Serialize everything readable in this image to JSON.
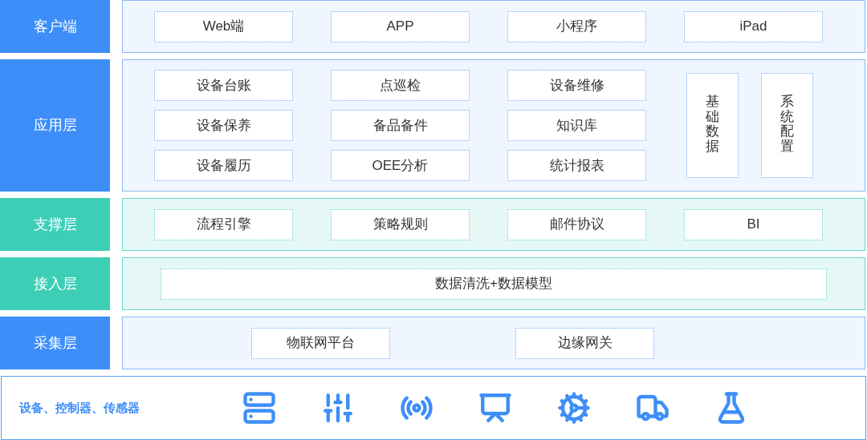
{
  "layers": [
    {
      "label": "客户端",
      "color": "#3d8ef8",
      "kind": "row",
      "items": [
        "Web端",
        "APP",
        "小程序",
        "iPad"
      ]
    },
    {
      "label": "应用层",
      "color": "#3d8ef8",
      "kind": "grid",
      "columns": [
        [
          "设备台账",
          "设备保养",
          "设备履历"
        ],
        [
          "点巡检",
          "备品备件",
          "OEE分析"
        ],
        [
          "设备维修",
          "知识库",
          "统计报表"
        ]
      ],
      "side_items": [
        "基础数据",
        "系统配置"
      ]
    },
    {
      "label": "支撑层",
      "color": "#3dcfb6",
      "kind": "row",
      "items": [
        "流程引擎",
        "策略规则",
        "邮件协议",
        "BI"
      ]
    },
    {
      "label": "接入层",
      "color": "#3dcfb6",
      "kind": "wide",
      "items": [
        "数据清洗+数据模型"
      ]
    },
    {
      "label": "采集层",
      "color": "#3d8ef8",
      "kind": "pair",
      "items": [
        "物联网平台",
        "边缘网关"
      ]
    }
  ],
  "devices": {
    "label": "设备、控制器、传感器"
  }
}
